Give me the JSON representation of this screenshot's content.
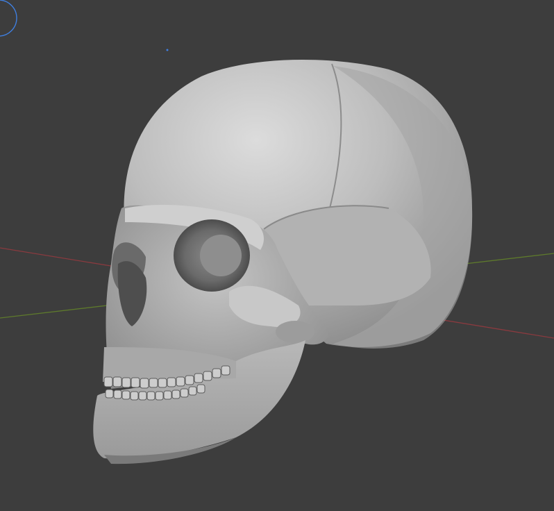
{
  "viewport": {
    "background": "#3d3d3d",
    "x_axis_color": "#8a3a3f",
    "y_axis_color": "#5e7a2c",
    "gizmo_color": "#3f7fe0",
    "object": "skull-mesh-icon",
    "skull_light": "#d8d8d8",
    "skull_mid": "#a9a9a9",
    "skull_dark": "#5a5a5a"
  }
}
